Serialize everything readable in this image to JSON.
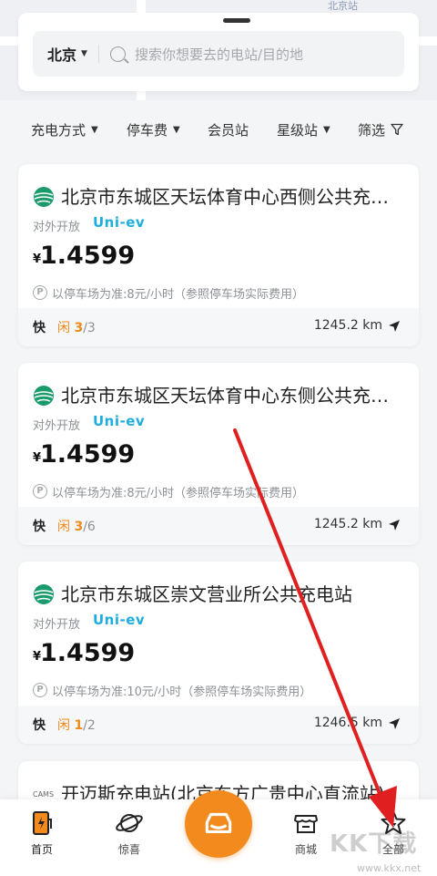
{
  "search": {
    "city": "北京",
    "placeholder": "搜索你想要去的电站/目的地"
  },
  "map": {
    "label": "北京站"
  },
  "filters": [
    {
      "label": "充电方式",
      "has_caret": true
    },
    {
      "label": "停车费",
      "has_caret": true
    },
    {
      "label": "会员站",
      "has_caret": false
    },
    {
      "label": "星级站",
      "has_caret": true
    },
    {
      "label": "筛选",
      "icon": "funnel-icon"
    }
  ],
  "stations": [
    {
      "name": "北京市东城区天坛体育中心西侧公共充…",
      "tag": "对外开放",
      "brand": "Uni-ev",
      "currency": "¥",
      "price": "1.4599",
      "parking": "以停车场为准:8元/小时（参照停车场实际费用）",
      "speed": "快",
      "idle_label": "闲",
      "idle": "3",
      "total": "/3",
      "distance": "1245.2 km"
    },
    {
      "name": "北京市东城区天坛体育中心东侧公共充…",
      "tag": "对外开放",
      "brand": "Uni-ev",
      "currency": "¥",
      "price": "1.4599",
      "parking": "以停车场为准:8元/小时（参照停车场实际费用）",
      "speed": "快",
      "idle_label": "闲",
      "idle": "3",
      "total": "/6",
      "distance": "1245.2 km"
    },
    {
      "name": "北京市东城区崇文营业所公共充电站",
      "tag": "对外开放",
      "brand": "Uni-ev",
      "currency": "¥",
      "price": "1.4599",
      "parking": "以停车场为准:10元/小时（参照停车场实际费用）",
      "speed": "快",
      "idle_label": "闲",
      "idle": "1",
      "total": "/2",
      "distance": "1246.5 km"
    },
    {
      "name": "开迈斯充电站(北京东方广贵中心直流站)"
    }
  ],
  "tabbar": {
    "items": [
      {
        "label": "首页",
        "icon": "home-charger-icon",
        "active": true
      },
      {
        "label": "惊喜",
        "icon": "planet-icon"
      },
      {
        "label": "",
        "icon": "car-icon"
      },
      {
        "label": "商城",
        "icon": "store-icon"
      },
      {
        "label": "全部",
        "icon": "star-bolt-icon"
      }
    ]
  },
  "watermark": {
    "text": "KK下载",
    "url": "www.kkx.net"
  },
  "colors": {
    "accent_orange": "#f28a1e",
    "idle_orange": "#f0891c",
    "brand_cyan": "#1faedc",
    "annotation_red": "#e02020"
  }
}
